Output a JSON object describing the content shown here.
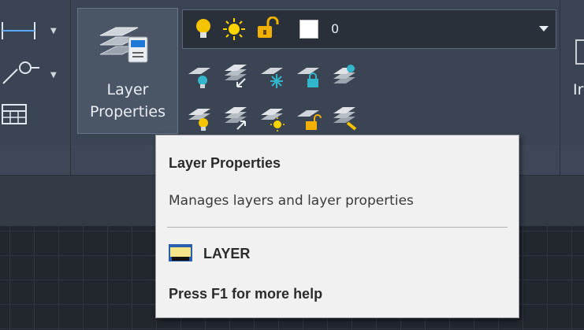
{
  "ribbon": {
    "layer_properties_button": {
      "line1": "Layer",
      "line2": "Properties",
      "icon": "layer-properties-icon"
    },
    "layer_combo": {
      "current_layer": "0",
      "state_icons": [
        "lightbulb-on-icon",
        "sun-thaw-icon",
        "padlock-unlocked-icon",
        "color-swatch-white"
      ]
    },
    "tool_row1_icons": [
      "layer-on-icon",
      "layer-match-icon",
      "layer-freeze-icon",
      "layer-lock-icon",
      "layer-states-icon"
    ],
    "tool_row2_icons": [
      "layer-off-icon",
      "layer-make-current-icon",
      "layer-thaw-icon",
      "layer-unlock-icon",
      "layer-isolate-icon"
    ],
    "left_tool_icons": [
      "dimension-icon",
      "leader-icon",
      "table-icon"
    ],
    "right_cutoff_text": "Ir"
  },
  "tooltip": {
    "title": "Layer Properties",
    "description": "Manages layers and layer properties",
    "command": "LAYER",
    "help": "Press F1 for more help",
    "command_icon": "layer-command-icon"
  },
  "colors": {
    "ribbon_bg": "#3b4452",
    "workspace_bg": "#22272e",
    "tooltip_bg": "#f1f1f1",
    "bulb_yellow": "#f4c400",
    "sun_yellow": "#ffd500",
    "lock_gold": "#f2b100",
    "teal": "#33b5cc"
  }
}
